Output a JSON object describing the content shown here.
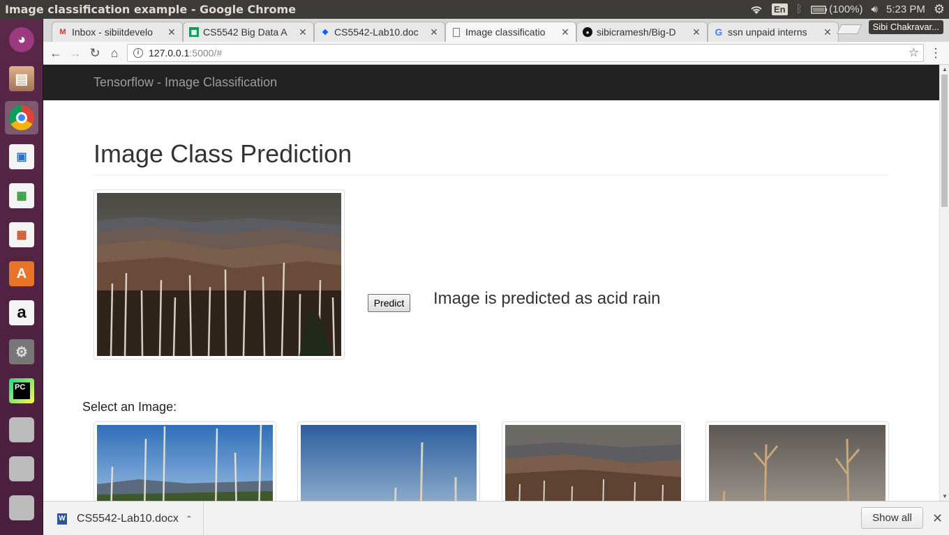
{
  "window": {
    "title": "Image classification example - Google Chrome"
  },
  "tray": {
    "lang": "En",
    "battery": "(100%)",
    "time": "5:23 PM"
  },
  "tabs": [
    {
      "label": "Inbox - sibiitdevelo",
      "icon": "gmail-icon",
      "color": "#d93025"
    },
    {
      "label": "CS5542 Big Data A",
      "icon": "sheets-icon",
      "color": "#0f9d58"
    },
    {
      "label": "CS5542-Lab10.doc",
      "icon": "dropbox-icon",
      "color": "#0061fe"
    },
    {
      "label": "Image classificatio",
      "icon": "page-icon",
      "color": "#666666",
      "active": true
    },
    {
      "label": "sibicramesh/Big-D",
      "icon": "github-icon",
      "color": "#111111"
    },
    {
      "label": "ssn unpaid interns",
      "icon": "google-icon",
      "color": "#4285f4"
    }
  ],
  "profile": {
    "name": "Sibi Chakravar..."
  },
  "address": {
    "host": "127.0.0.1",
    "path": ":5000/#"
  },
  "page": {
    "brand": "Tensorflow - Image Classification",
    "title": "Image Class Prediction",
    "predict_label": "Predict",
    "result_text": "Image is predicted as acid rain",
    "select_label": "Select an Image:"
  },
  "downloads": {
    "file_name": "CS5542-Lab10.docx",
    "show_all": "Show all"
  },
  "launcher": [
    "ubuntu-icon",
    "files-icon",
    "chrome-icon",
    "writer-icon",
    "calc-icon",
    "impress-icon",
    "software-center-icon",
    "amazon-icon",
    "settings-icon",
    "pycharm-icon",
    "drive-icon",
    "drive-icon",
    "drive-icon"
  ]
}
